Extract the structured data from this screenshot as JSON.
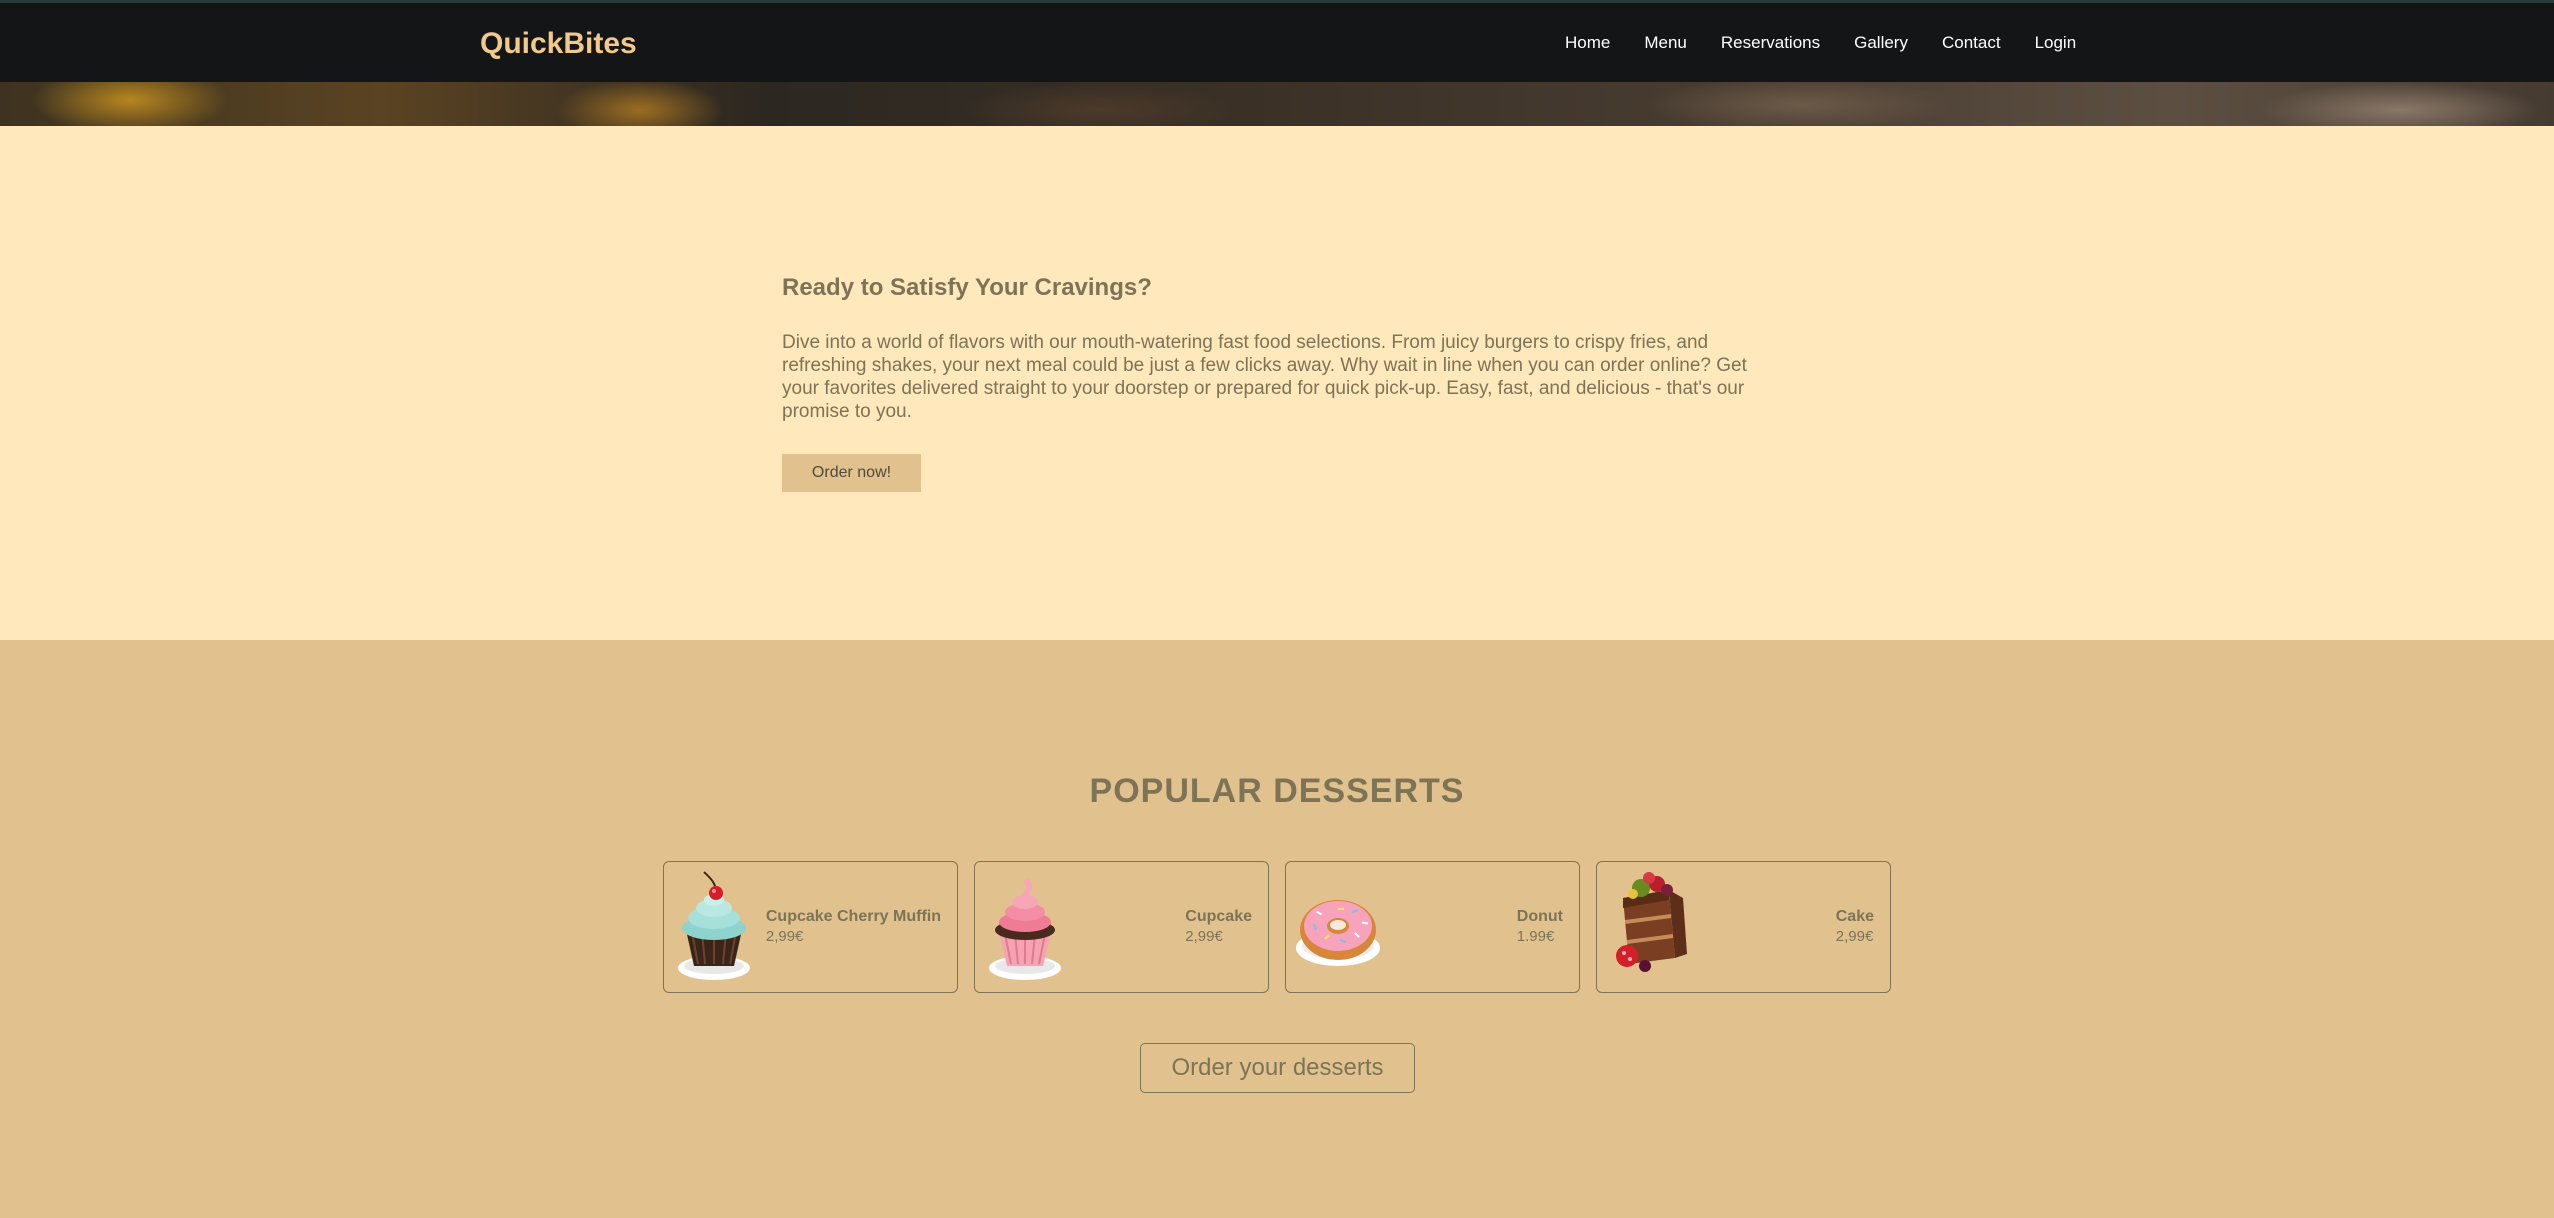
{
  "brand": "QuickBites",
  "nav": {
    "items": [
      {
        "label": "Home",
        "id": "home"
      },
      {
        "label": "Menu",
        "id": "menu"
      },
      {
        "label": "Reservations",
        "id": "reservations"
      },
      {
        "label": "Gallery",
        "id": "gallery"
      },
      {
        "label": "Contact",
        "id": "contact"
      },
      {
        "label": "Login",
        "id": "login"
      }
    ]
  },
  "intro": {
    "title": "Ready to Satisfy Your Cravings?",
    "text": "Dive into a world of flavors with our mouth-watering fast food selections. From juicy burgers to crispy fries, and refreshing shakes, your next meal could be just a few clicks away. Why wait in line when you can order online? Get your favorites delivered straight to your doorstep or prepared for quick pick-up. Easy, fast, and delicious - that's our promise to you.",
    "cta": "Order now!"
  },
  "desserts": {
    "title": "POPULAR DESSERTS",
    "items": [
      {
        "name": "Cupcake Cherry Muffin",
        "price": "2,99€",
        "icon": "cupcake-cherry-icon"
      },
      {
        "name": "Cupcake",
        "price": "2,99€",
        "icon": "cupcake-icon"
      },
      {
        "name": "Donut",
        "price": "1.99€",
        "icon": "donut-icon"
      },
      {
        "name": "Cake",
        "price": "2,99€",
        "icon": "cake-icon"
      }
    ],
    "cta": "Order your desserts"
  },
  "colors": {
    "navbar": "#131517",
    "brand": "#f2c98a",
    "intro_bg": "#ffe8bc",
    "desserts_bg": "#e1c28f",
    "text": "#7d7356"
  }
}
